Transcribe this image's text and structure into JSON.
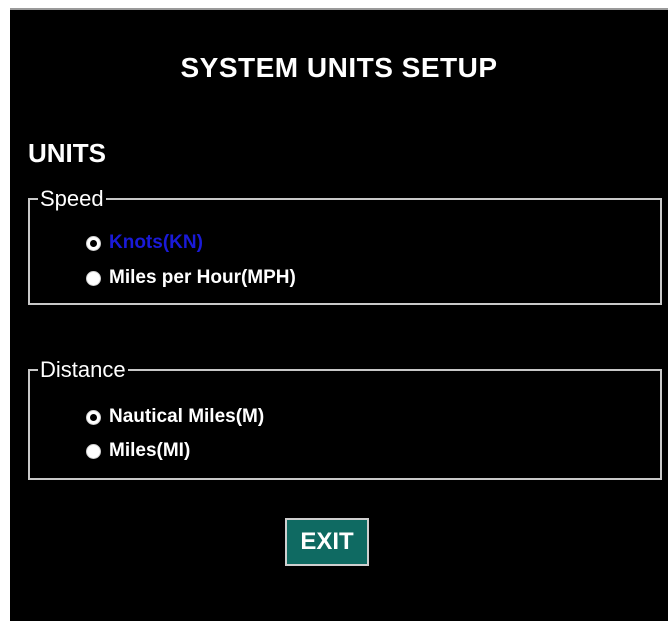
{
  "header": {
    "title": "SYSTEM UNITS SETUP"
  },
  "units": {
    "heading": "UNITS",
    "speed": {
      "label": "Speed",
      "selected": "Knots(KN)",
      "options": [
        {
          "label": "Knots(KN)",
          "checked": true
        },
        {
          "label": "Miles per Hour(MPH)",
          "checked": false
        }
      ]
    },
    "distance": {
      "label": "Distance",
      "selected": "Nautical Miles(M)",
      "options": [
        {
          "label": "Nautical Miles(M)",
          "checked": true
        },
        {
          "label": "Miles(MI)",
          "checked": false
        }
      ]
    }
  },
  "actions": {
    "exit_label": "EXIT"
  },
  "colors": {
    "background": "#000000",
    "text": "#ffffff",
    "highlight_text": "#1a1ad8",
    "exit_button_bg": "#0f6a62",
    "group_border": "#c8c8c8"
  }
}
